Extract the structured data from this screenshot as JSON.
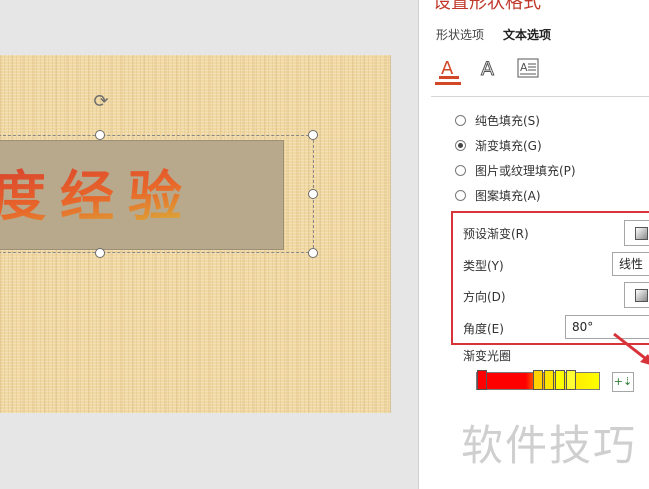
{
  "slide": {
    "text": "度经验"
  },
  "pane": {
    "title": "设置形状格式",
    "tabs": [
      {
        "label": "形状选项"
      },
      {
        "label": "文本选项"
      }
    ],
    "category_icons": [
      "text-fill-icon",
      "text-outline-icon",
      "text-box-icon"
    ],
    "fill_options": [
      {
        "label": "纯色填充(S)",
        "checked": false
      },
      {
        "label": "渐变填充(G)",
        "checked": true
      },
      {
        "label": "图片或纹理填充(P)",
        "checked": false
      },
      {
        "label": "图案填充(A)",
        "checked": false
      }
    ],
    "preset_label": "预设渐变(R)",
    "type_label": "类型(Y)",
    "type_value": "线性",
    "direction_label": "方向(D)",
    "angle_label": "角度(E)",
    "angle_value": "80°",
    "stops_label": "渐变光圈",
    "stop_colors": [
      "#ff0000",
      "#ff3b00",
      "#ffd200",
      "#ffe400",
      "#ffff00",
      "#ffff33"
    ]
  },
  "watermark": "软件技巧",
  "colors": {
    "accent": "#d24726",
    "highlight": "#d9333a"
  }
}
